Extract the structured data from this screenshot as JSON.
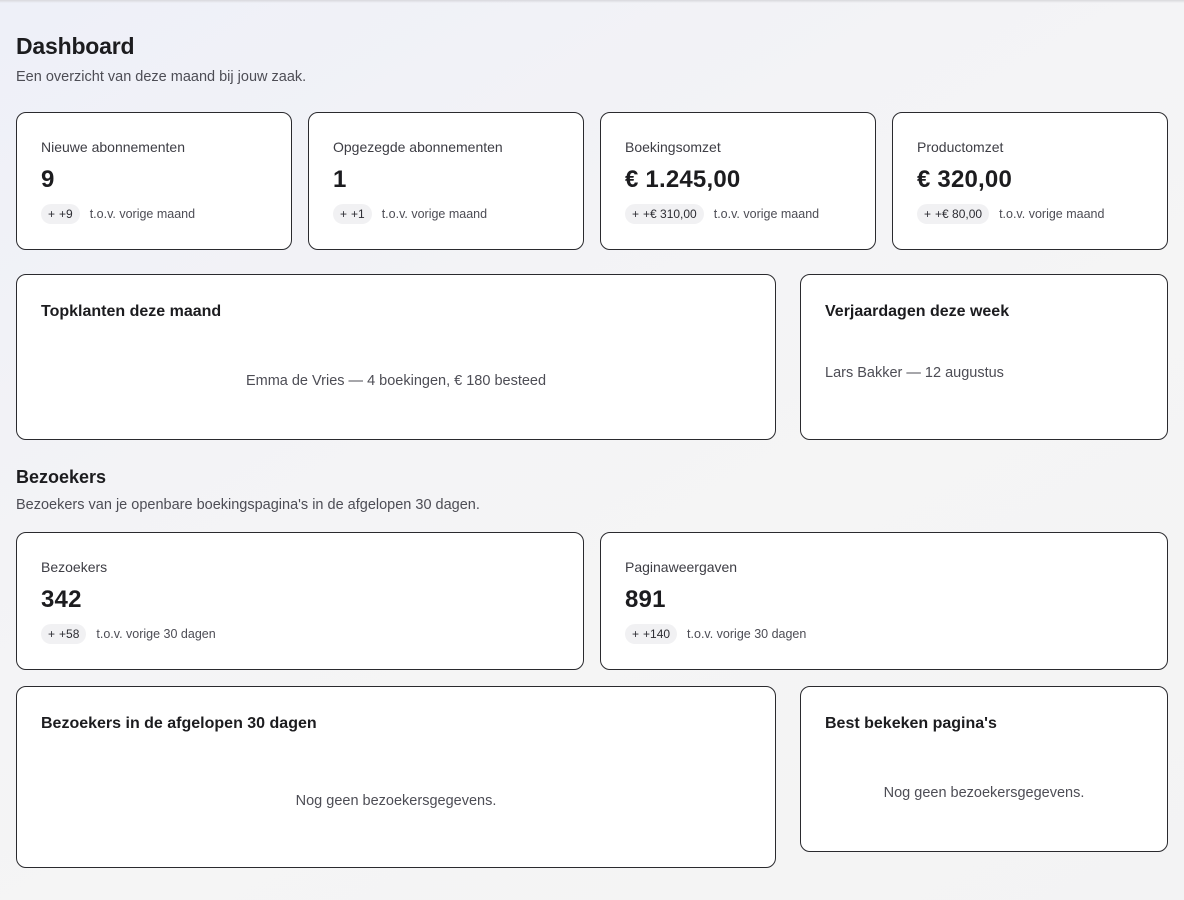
{
  "header": {
    "title": "Dashboard",
    "subtitle": "Een overzicht van deze maand bij jouw zaak."
  },
  "stats": [
    {
      "label": "Nieuwe abonnementen",
      "value": "9",
      "delta": "+9",
      "delta_text": "t.o.v. vorige maand"
    },
    {
      "label": "Opgezegde abonnementen",
      "value": "1",
      "delta": "+1",
      "delta_text": "t.o.v. vorige maand"
    },
    {
      "label": "Boekingsomzet",
      "value": "€ 1.245,00",
      "delta": "+€ 310,00",
      "delta_text": "t.o.v. vorige maand"
    },
    {
      "label": "Productomzet",
      "value": "€ 320,00",
      "delta": "+€ 80,00",
      "delta_text": "t.o.v. vorige maand"
    }
  ],
  "top_clients": {
    "title": "Topklanten deze maand",
    "entry": "Emma de Vries — 4 boekingen, € 180 besteed"
  },
  "birthdays": {
    "title": "Verjaardagen deze week",
    "entry": "Lars Bakker — 12 augustus"
  },
  "visitors_section": {
    "title": "Bezoekers",
    "subtitle": "Bezoekers van je openbare boekingspagina's in de afgelopen 30 dagen."
  },
  "visitor_stats": [
    {
      "label": "Bezoekers",
      "value": "342",
      "delta": "+58",
      "delta_text": "t.o.v. vorige 30 dagen"
    },
    {
      "label": "Paginaweergaven",
      "value": "891",
      "delta": "+140",
      "delta_text": "t.o.v. vorige 30 dagen"
    }
  ],
  "visitors_chart": {
    "title": "Bezoekers in de afgelopen 30 dagen",
    "empty": "Nog geen bezoekersgegevens."
  },
  "top_pages": {
    "title": "Best bekeken pagina's",
    "empty": "Nog geen bezoekersgegevens."
  },
  "delta_prefix": "+"
}
